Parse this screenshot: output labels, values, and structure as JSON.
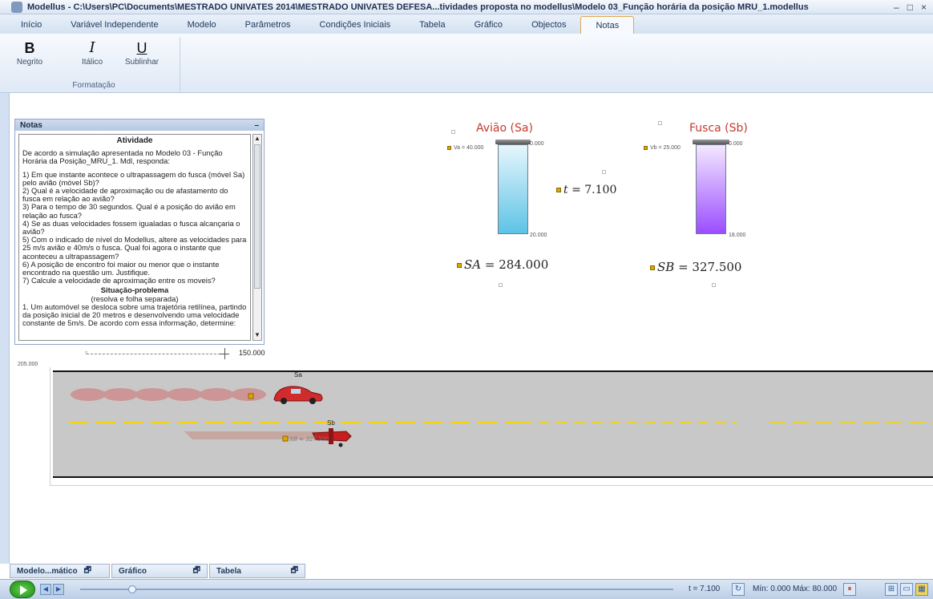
{
  "window": {
    "title": "Modellus - C:\\Users\\PC\\Documents\\MESTRADO UNIVATES 2014\\MESTRADO UNIVATES  DEFESA...tividades proposta no modellus\\Modelo 03_Função horária da posição MRU_1.modellus",
    "controls": [
      "–",
      "□",
      "×"
    ]
  },
  "tabs": [
    "Início",
    "Variável Independente",
    "Modelo",
    "Parâmetros",
    "Condições Iniciais",
    "Tabela",
    "Gráfico",
    "Objectos",
    "Notas"
  ],
  "active_tab": "Notas",
  "ribbon": {
    "bold_glyph": "B",
    "bold_label": "Negrito",
    "italic_glyph": "I",
    "italic_label": "Itálico",
    "underline_glyph": "U",
    "underline_label": "Sublinhar",
    "group_name": "Formatação"
  },
  "notes": {
    "header": "Notas",
    "collapse": "–",
    "heading": "Atividade",
    "intro": "De acordo a simulação apresentada no Modelo 03 - Função Horária da Posição_MRU_1. Mdl, responda:",
    "q1": "1) Em que instante acontece o ultrapassagem do fusca (móvel Sa) pelo avião (móvel Sb)?",
    "q2": "2) Qual é a velocidade de aproximação ou de afastamento do fusca em relação ao avião?",
    "q3": "3) Para o tempo de 30 segundos. Qual é a posição do avião em relação ao fusca?",
    "q4": "4) Se as duas velocidades fossem igualadas o fusca alcançaria o avião?",
    "q5": "5) Com o indicado de nível do Modellus, altere as velocidades para 25 m/s avião e 40m/s o fusca. Qual foi agora o instante que aconteceu a ultrapassagem?",
    "q6": "6) A posição de encontro foi maior ou menor que o instante encontrado na questão um. Justifique.",
    "q7": "7) Calcule a velocidade de aproximação entre os moveis?",
    "problem_heading": "Situação-problema",
    "problem_sub": "(resolva e folha separada)",
    "problem_text": "1. Um automóvel se desloca sobre uma trajetória retilínea, partindo da posição inicial de 20 metros e desenvolvendo uma velocidade constante de 5m/s. De acordo com essa informação, determine:"
  },
  "meters": {
    "a": {
      "title": "Avião (Sa)",
      "var_label": "Va = 40.000",
      "top": "0.000",
      "bottom": "20.000",
      "color_top": "#e6f6fc",
      "color_bottom": "#5ec3e6"
    },
    "b": {
      "title": "Fusca (Sb)",
      "var_label": "Vb = 25.000",
      "top": "0.000",
      "bottom": "18.000",
      "color_top": "#f3e8ff",
      "color_bottom": "#9b4dff"
    }
  },
  "values": {
    "t_label": "t",
    "t_value": "= 7.100",
    "sa_label": "SA",
    "sa_value": "= 284.000",
    "sb_label": "SB",
    "sb_value": "= 327.500"
  },
  "slider": {
    "value": "150.000"
  },
  "road": {
    "axis_value": "205.000",
    "car_label": "Sa",
    "plane_label": "Sb",
    "plane_value": "SB = 327.500",
    "road_color": "#c8c8c8",
    "lane_color": "#f2d20b"
  },
  "bottom_tabs": [
    "Modelo...mático",
    "Gráfico",
    "Tabela"
  ],
  "statusbar": {
    "t_readout": "t = 7.100",
    "range": "Mín: 0.000 Máx: 80.000"
  }
}
